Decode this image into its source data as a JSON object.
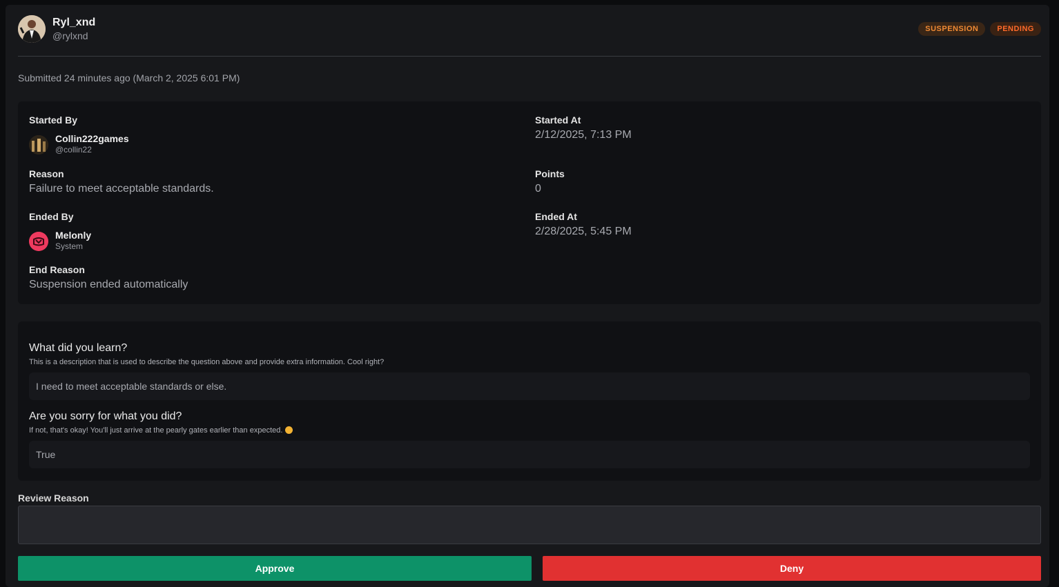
{
  "header": {
    "username": "Ryl_xnd",
    "handle": "@rylxnd",
    "badges": [
      "SUSPENSION",
      "PENDING"
    ]
  },
  "submitted": "Submitted 24 minutes ago (March 2, 2025 6:01 PM)",
  "details": {
    "started_by_label": "Started By",
    "started_by_name": "Collin222games",
    "started_by_handle": "@collin22",
    "started_at_label": "Started At",
    "started_at_value": "2/12/2025, 7:13 PM",
    "reason_label": "Reason",
    "reason_value": "Failure to meet acceptable standards.",
    "points_label": "Points",
    "points_value": "0",
    "ended_by_label": "Ended By",
    "ended_by_name": "Melonly",
    "ended_by_sub": "System",
    "ended_at_label": "Ended At",
    "ended_at_value": "2/28/2025, 5:45 PM",
    "end_reason_label": "End Reason",
    "end_reason_value": "Suspension ended automatically"
  },
  "questions": [
    {
      "title": "What did you learn?",
      "description": "This is a description that is used to describe the question above and provide extra information. Cool right?",
      "answer": "I need to meet acceptable standards or else."
    },
    {
      "title": "Are you sorry for what you did?",
      "description": "If not, that's okay! You'll just arrive at the pearly gates earlier than expected.",
      "answer": "True"
    }
  ],
  "review": {
    "label": "Review Reason",
    "value": ""
  },
  "actions": {
    "approve": "Approve",
    "deny": "Deny"
  },
  "colors": {
    "approve": "#0d9268",
    "deny": "#e13131",
    "badge_text": "#f08a34",
    "melonly": "#ee3a5f"
  }
}
